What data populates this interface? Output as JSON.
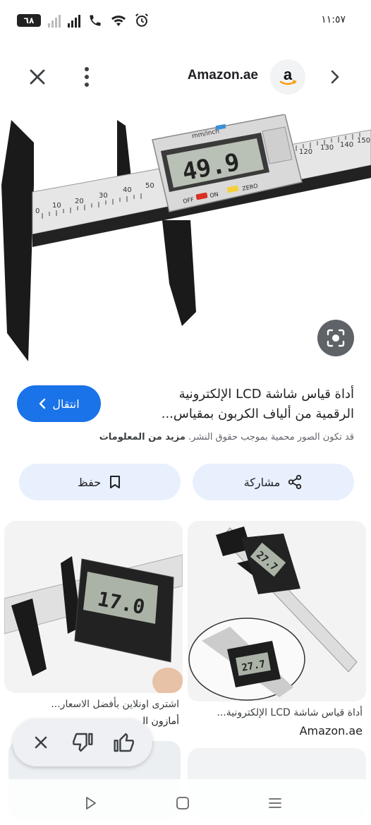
{
  "status_bar": {
    "battery": "٦٨",
    "clock": "١١:٥٧"
  },
  "header": {
    "source_title": "Amazon.ae",
    "icons": [
      "close-icon",
      "more-vert-icon",
      "amazon-logo",
      "chevron-right-icon"
    ]
  },
  "main_image": {
    "display_reading": "49.9",
    "unit_label": "mm/inch",
    "buttons": [
      "OFF",
      "ON",
      "ZERO"
    ],
    "scale_numbers": [
      "0",
      "10",
      "20",
      "30",
      "40",
      "50",
      "120",
      "130",
      "140",
      "150"
    ]
  },
  "result": {
    "title": "أداة قياس شاشة LCD الإلكترونية الرقمية من ألياف الكربون بمقياس...",
    "go_button": "انتقال",
    "copyright_text": "قد تكون الصور محمية بموجب حقوق النشر.",
    "more_info": "مزيد من المعلومات"
  },
  "actions": {
    "share_label": "مشاركة",
    "save_label": "حفظ"
  },
  "related": [
    {
      "caption": "أداة قياس شاشة LCD الإلكترونية...",
      "source": "Amazon.ae",
      "reading": "27.7"
    },
    {
      "caption": "اشترى اونلاين بأفضل الاسعار...",
      "source": "أمازون ال",
      "reading": "17.0"
    }
  ],
  "feedback": {
    "icons": [
      "close-icon",
      "thumbs-down-icon",
      "thumbs-up-icon"
    ]
  },
  "navbar": {
    "icons": [
      "back-icon",
      "home-icon",
      "recents-icon"
    ]
  },
  "colors": {
    "accent": "#1a73e8",
    "chip_bg": "#e8f0fe"
  }
}
